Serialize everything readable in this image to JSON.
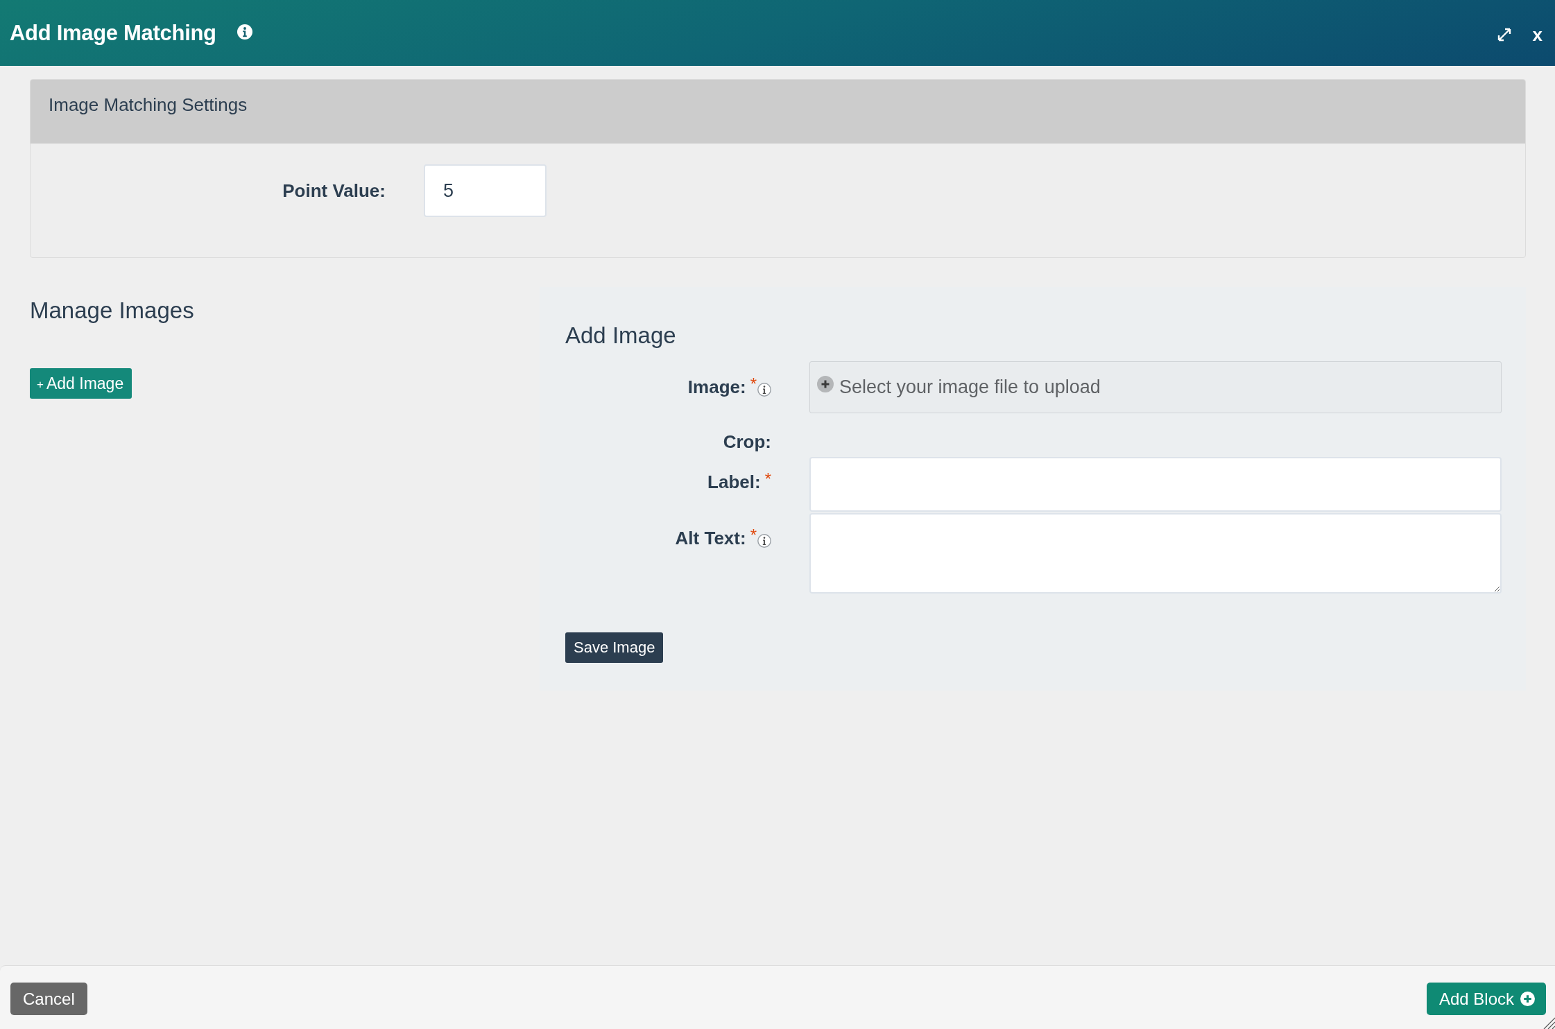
{
  "dialog": {
    "title": "Add Image Matching",
    "close": "x"
  },
  "settings": {
    "title": "Image Matching Settings",
    "fields": [
      {
        "label": "Point Value:",
        "value": "5"
      }
    ]
  },
  "manage_images": {
    "title": "Manage Images",
    "add_button": {
      "icon": "+",
      "label": "Add Image"
    }
  },
  "add_image": {
    "title": "Add Image",
    "fields": [
      {
        "kind": "file",
        "label": "Image:",
        "required_mark": "*",
        "info": true,
        "placeholder": "Select your image file to upload"
      },
      {
        "kind": "static",
        "label": "Crop:",
        "info": false
      },
      {
        "kind": "text",
        "label": "Label:",
        "required_mark": "*",
        "info": false
      },
      {
        "kind": "textarea",
        "label": "Alt Text:",
        "required_mark": "*",
        "info": true
      }
    ],
    "save_button": "Save Image"
  },
  "footer": {
    "buttons": [
      {
        "kind": "secondary",
        "label": "Cancel"
      },
      {
        "kind": "primary",
        "label": "Add Block"
      }
    ]
  }
}
